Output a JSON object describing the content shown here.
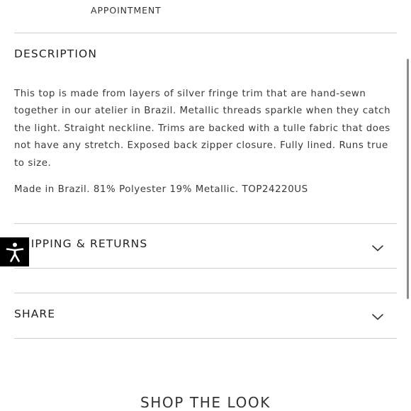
{
  "appointment": {
    "label": "APPOINTMENT"
  },
  "description_section": {
    "title": "DESCRIPTION",
    "paragraph_lines": [
      "This top is made from layers of silver fringe trim that are hand-sewn",
      "together in our atelier in Brazil.  Metallic threads sparkle when they catch",
      "the light.  Straight neckline.  Trims are backed with a tulle fabric that does",
      "not have any stretch.  Exposed back zipper closure.  Fully lined.  Runs true",
      "to size."
    ],
    "made_in": "Made in Brazil. 81% Polyester  19% Metallic. TOP24220US"
  },
  "shipping_section": {
    "title": "SHIPPING & RETURNS",
    "icon": "chevron-down-icon"
  },
  "share_section": {
    "title": "SHARE",
    "icon": "chevron-down-icon"
  },
  "accessibility": {
    "icon": "accessibility-icon",
    "background": "#000000"
  },
  "shop_the_look": {
    "title": "SHOP THE LOOK"
  }
}
